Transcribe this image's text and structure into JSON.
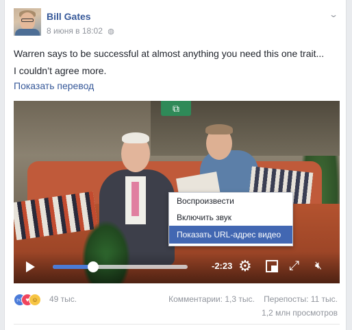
{
  "post": {
    "author": "Bill Gates",
    "date": "8 июня в 18:02",
    "privacy_icon": "globe-icon",
    "text_line1": "Warren says to be successful at almost anything you need this one trait...",
    "text_line2": "I couldn’t agree more.",
    "translate_link": "Показать перевод"
  },
  "video": {
    "pip_icon": "⧉",
    "time_remaining": "-2:23",
    "progress": 0.3,
    "context_menu": {
      "items": [
        "Воспроизвести",
        "Включить звук",
        "Показать URL-адрес видео"
      ],
      "highlighted_index": 2
    }
  },
  "footer": {
    "reaction_count": "49 тыс.",
    "comments": "Комментарии: 1,3 тыс.",
    "shares": "Перепосты: 11 тыс.",
    "views": "1,2 млн просмотров"
  },
  "colors": {
    "link": "#365899",
    "accent": "#4267b2",
    "progress": "#4b7bd6"
  }
}
